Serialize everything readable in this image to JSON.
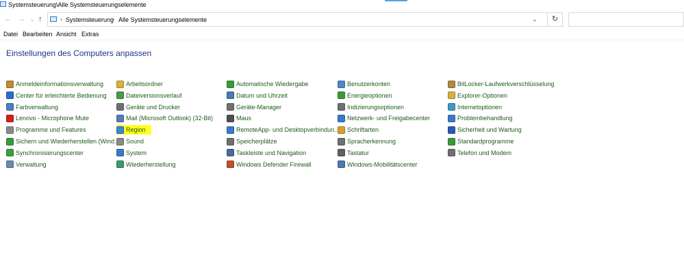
{
  "window": {
    "title": "Systemsteuerung\\Alle Systemsteuerungselemente"
  },
  "nav": {
    "back": "←",
    "forward": "→",
    "history": "⌄",
    "up": "↑",
    "separator": "›",
    "breadcrumbs": [
      "Systemsteuerung",
      "Alle Systemsteuerungselemente"
    ],
    "dropdown": "⌄",
    "refresh": "↻"
  },
  "menu": [
    "Datei",
    "Bearbeiten",
    "Ansicht",
    "Extras"
  ],
  "page_title": "Einstellungen des Computers anpassen",
  "columns": [
    [
      {
        "label": "Anmeldeinformationsverwaltung",
        "icon": "credential-manager-icon",
        "color": "#c08a2e"
      },
      {
        "label": "Center für erleichterte Bedienung",
        "icon": "ease-of-access-icon",
        "color": "#2b6fc4"
      },
      {
        "label": "Farbverwaltung",
        "icon": "color-management-icon",
        "color": "#4a7fc0"
      },
      {
        "label": "Lenovo - Microphone Mute",
        "icon": "microphone-mute-icon",
        "color": "#d22020"
      },
      {
        "label": "Programme und Features",
        "icon": "programs-features-icon",
        "color": "#8a8a8a"
      },
      {
        "label": "Sichern und Wiederherstellen (Wind...",
        "icon": "backup-restore-icon",
        "color": "#3a9a3a"
      },
      {
        "label": "Synchronisierungscenter",
        "icon": "sync-center-icon",
        "color": "#3aa040"
      },
      {
        "label": "Verwaltung",
        "icon": "administrative-tools-icon",
        "color": "#6a8ab0"
      }
    ],
    [
      {
        "label": "Arbeitsordner",
        "icon": "work-folders-icon",
        "color": "#d8b040"
      },
      {
        "label": "Dateiversionsverlauf",
        "icon": "file-history-icon",
        "color": "#4a9a4a"
      },
      {
        "label": "Geräte und Drucker",
        "icon": "devices-printers-icon",
        "color": "#707070"
      },
      {
        "label": "Mail (Microsoft Outlook) (32-Bit)",
        "icon": "mail-icon",
        "color": "#5a7ab8"
      },
      {
        "label": "Region",
        "icon": "region-icon",
        "color": "#3a8ad0",
        "highlight": true
      },
      {
        "label": "Sound",
        "icon": "sound-icon",
        "color": "#8a8a8a"
      },
      {
        "label": "System",
        "icon": "system-icon",
        "color": "#3a7ac8"
      },
      {
        "label": "Wiederherstellung",
        "icon": "recovery-icon",
        "color": "#3a9a6a"
      }
    ],
    [
      {
        "label": "Automatische Wiedergabe",
        "icon": "autoplay-icon",
        "color": "#3a9a3a"
      },
      {
        "label": "Datum und Uhrzeit",
        "icon": "date-time-icon",
        "color": "#4a7ab0"
      },
      {
        "label": "Geräte-Manager",
        "icon": "device-manager-icon",
        "color": "#707070"
      },
      {
        "label": "Maus",
        "icon": "mouse-icon",
        "color": "#505050"
      },
      {
        "label": "RemoteApp- und Desktopverbindun...",
        "icon": "remoteapp-icon",
        "color": "#3a7ac8"
      },
      {
        "label": "Speicherplätze",
        "icon": "storage-spaces-icon",
        "color": "#707070"
      },
      {
        "label": "Taskleiste und Navigation",
        "icon": "taskbar-icon",
        "color": "#4a6a9a"
      },
      {
        "label": "Windows Defender Firewall",
        "icon": "firewall-icon",
        "color": "#c05030"
      }
    ],
    [
      {
        "label": "Benutzerkonten",
        "icon": "user-accounts-icon",
        "color": "#4a8ac8"
      },
      {
        "label": "Energieoptionen",
        "icon": "power-options-icon",
        "color": "#3a9a3a"
      },
      {
        "label": "Indizierungsoptionen",
        "icon": "indexing-options-icon",
        "color": "#707070"
      },
      {
        "label": "Netzwerk- und Freigabecenter",
        "icon": "network-center-icon",
        "color": "#3a7ac8"
      },
      {
        "label": "Schriftarten",
        "icon": "fonts-icon",
        "color": "#d8a030"
      },
      {
        "label": "Spracherkennung",
        "icon": "speech-recognition-icon",
        "color": "#707070"
      },
      {
        "label": "Tastatur",
        "icon": "keyboard-icon",
        "color": "#606060"
      },
      {
        "label": "Windows-Mobilitätscenter",
        "icon": "mobility-center-icon",
        "color": "#4a7ab0"
      }
    ],
    [
      {
        "label": "BitLocker-Laufwerkverschlüsselung",
        "icon": "bitlocker-icon",
        "color": "#b08a40"
      },
      {
        "label": "Explorer-Optionen",
        "icon": "explorer-options-icon",
        "color": "#d8b040"
      },
      {
        "label": "Internetoptionen",
        "icon": "internet-options-icon",
        "color": "#3a9ac8"
      },
      {
        "label": "Problembehandlung",
        "icon": "troubleshooting-icon",
        "color": "#3a7ac8"
      },
      {
        "label": "Sicherheit und Wartung",
        "icon": "security-maintenance-icon",
        "color": "#2a5ab8"
      },
      {
        "label": "Standardprogramme",
        "icon": "default-programs-icon",
        "color": "#3a9a3a"
      },
      {
        "label": "Telefon und Modem",
        "icon": "phone-modem-icon",
        "color": "#707070"
      }
    ]
  ]
}
